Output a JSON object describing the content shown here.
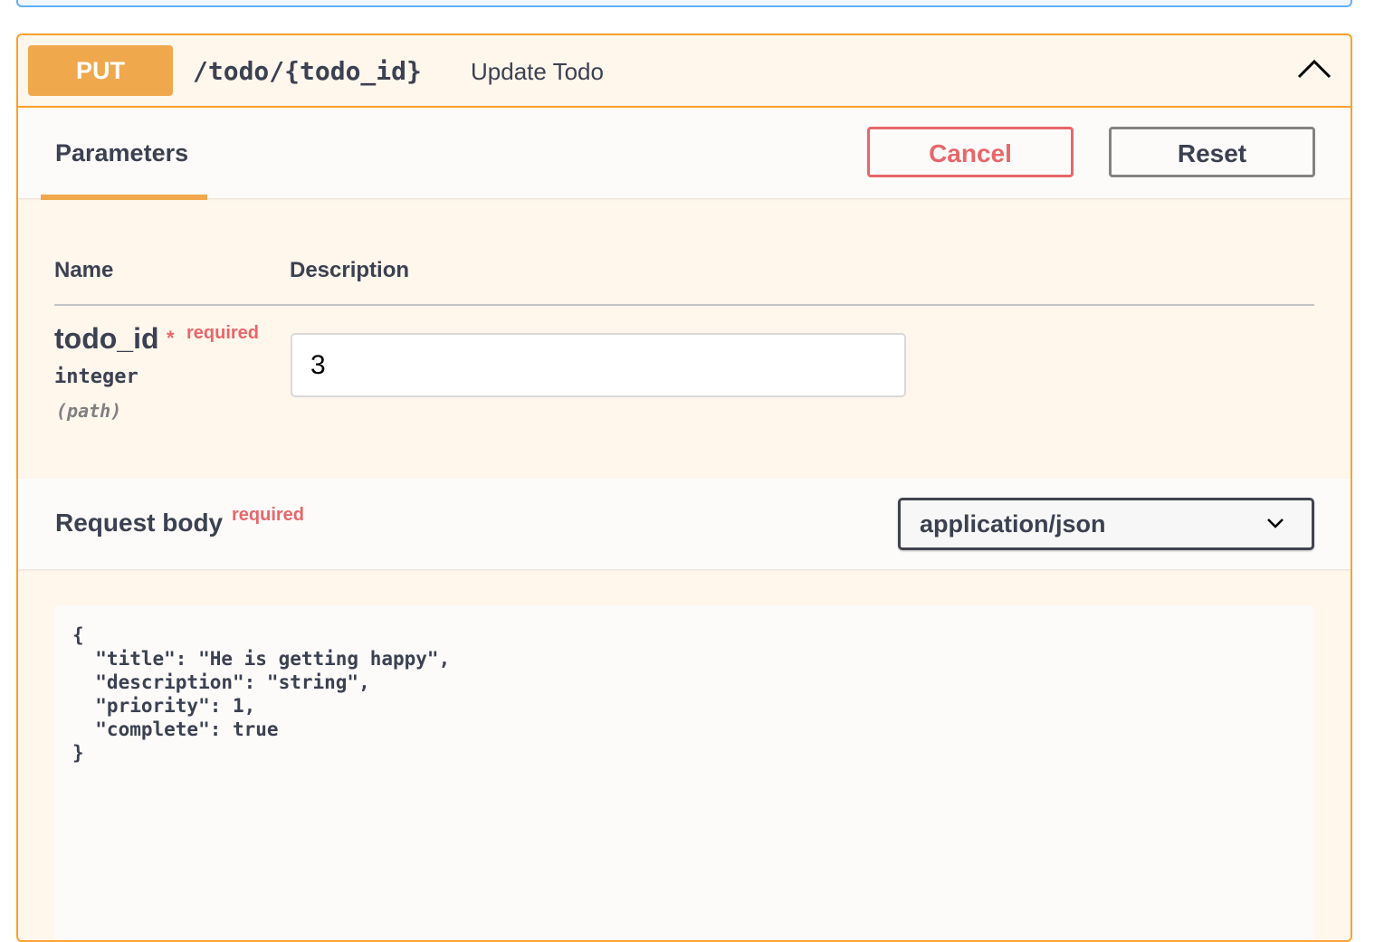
{
  "operation": {
    "method": "PUT",
    "path": "/todo/{todo_id}",
    "summary": "Update Todo",
    "collapse_icon": "chevron-up-icon"
  },
  "tabs": {
    "parameters_label": "Parameters",
    "cancel_label": "Cancel",
    "reset_label": "Reset"
  },
  "parameters": {
    "headers": {
      "name": "Name",
      "description": "Description"
    },
    "rows": [
      {
        "name": "todo_id",
        "required_star": "*",
        "required_label": "required",
        "type": "integer",
        "in": "(path)",
        "value": "3"
      }
    ]
  },
  "request_body": {
    "title": "Request body",
    "required_label": "required",
    "content_type": "application/json",
    "dropdown_icon": "chevron-down-icon",
    "body": "{\n  \"title\": \"He is getting happy\",\n  \"description\": \"string\",\n  \"priority\": 1,\n  \"complete\": true\n}"
  },
  "colors": {
    "method_put": "#f0a84c",
    "opblock_border": "#fca130",
    "opblock_bg": "#fff6ec",
    "cancel": "#e7676a",
    "required": "#e7676a",
    "prev_block_border": "#61affe"
  }
}
